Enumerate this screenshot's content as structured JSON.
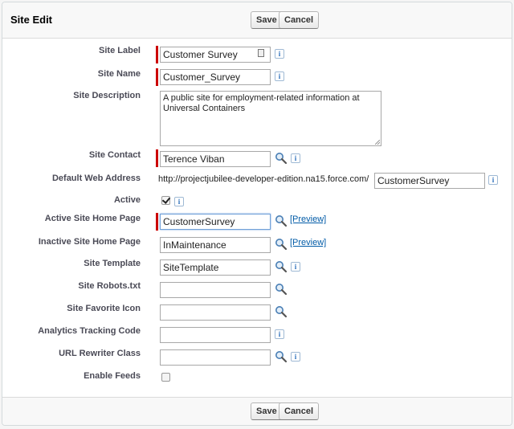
{
  "header": {
    "title": "Site Edit",
    "save_label": "Save",
    "cancel_label": "Cancel"
  },
  "footer": {
    "save_label": "Save",
    "cancel_label": "Cancel"
  },
  "fields": {
    "site_label": {
      "label": "Site Label",
      "value": "Customer Survey"
    },
    "site_name": {
      "label": "Site Name",
      "value": "Customer_Survey"
    },
    "site_description": {
      "label": "Site Description",
      "value": "A public site for employment-related information at Universal Containers"
    },
    "site_contact": {
      "label": "Site Contact",
      "value": "Terence Viban"
    },
    "default_web_address": {
      "label": "Default Web Address",
      "prefix": "http://projectjubilee-developer-edition.na15.force.com/",
      "value": "CustomerSurvey"
    },
    "active": {
      "label": "Active",
      "checked": true
    },
    "active_home": {
      "label": "Active Site Home Page",
      "value": "CustomerSurvey",
      "preview": "[Preview]"
    },
    "inactive_home": {
      "label": "Inactive Site Home Page",
      "value": "InMaintenance",
      "preview": "[Preview]"
    },
    "site_template": {
      "label": "Site Template",
      "value": "SiteTemplate"
    },
    "robots": {
      "label": "Site Robots.txt",
      "value": ""
    },
    "favicon": {
      "label": "Site Favorite Icon",
      "value": ""
    },
    "analytics": {
      "label": "Analytics Tracking Code",
      "value": ""
    },
    "url_rewriter": {
      "label": "URL Rewriter Class",
      "value": ""
    },
    "enable_feeds": {
      "label": "Enable Feeds",
      "checked": false
    }
  },
  "icons": {
    "info": "info-icon",
    "lookup": "lookup-magnifier-icon"
  },
  "colors": {
    "required": "#cc0000",
    "link": "#015ba7",
    "label": "#4a4a56"
  }
}
